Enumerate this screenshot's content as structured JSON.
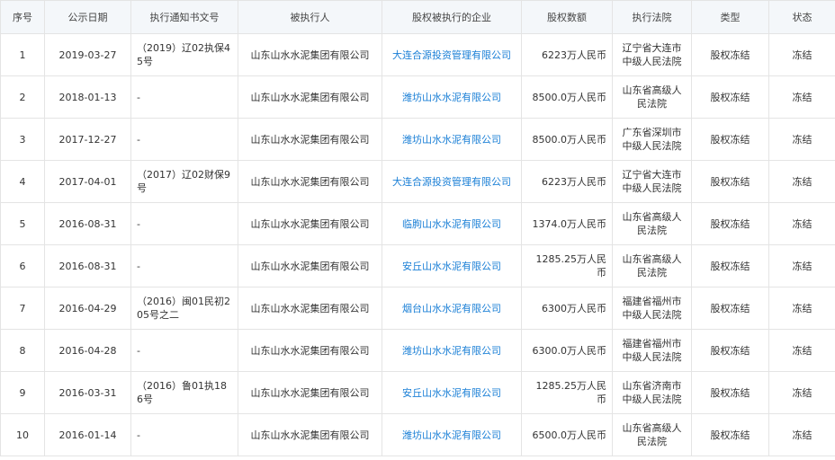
{
  "table": {
    "headers": {
      "index": "序号",
      "date": "公示日期",
      "notice_no": "执行通知书文号",
      "executee": "被执行人",
      "company": "股权被执行的企业",
      "amount": "股权数额",
      "court": "执行法院",
      "type": "类型",
      "status": "状态"
    },
    "rows": [
      {
        "index": "1",
        "date": "2019-03-27",
        "notice_no": "（2019）辽02执保45号",
        "executee": "山东山水水泥集团有限公司",
        "company": "大连合源投资管理有限公司",
        "amount": "6223万人民币",
        "court": "辽宁省大连市中级人民法院",
        "type": "股权冻结",
        "status": "冻结"
      },
      {
        "index": "2",
        "date": "2018-01-13",
        "notice_no": "-",
        "executee": "山东山水水泥集团有限公司",
        "company": "潍坊山水水泥有限公司",
        "amount": "8500.0万人民币",
        "court": "山东省高级人民法院",
        "type": "股权冻结",
        "status": "冻结"
      },
      {
        "index": "3",
        "date": "2017-12-27",
        "notice_no": "-",
        "executee": "山东山水水泥集团有限公司",
        "company": "潍坊山水水泥有限公司",
        "amount": "8500.0万人民币",
        "court": "广东省深圳市中级人民法院",
        "type": "股权冻结",
        "status": "冻结"
      },
      {
        "index": "4",
        "date": "2017-04-01",
        "notice_no": "（2017）辽02财保9号",
        "executee": "山东山水水泥集团有限公司",
        "company": "大连合源投资管理有限公司",
        "amount": "6223万人民币",
        "court": "辽宁省大连市中级人民法院",
        "type": "股权冻结",
        "status": "冻结"
      },
      {
        "index": "5",
        "date": "2016-08-31",
        "notice_no": "-",
        "executee": "山东山水水泥集团有限公司",
        "company": "临朐山水水泥有限公司",
        "amount": "1374.0万人民币",
        "court": "山东省高级人民法院",
        "type": "股权冻结",
        "status": "冻结"
      },
      {
        "index": "6",
        "date": "2016-08-31",
        "notice_no": "-",
        "executee": "山东山水水泥集团有限公司",
        "company": "安丘山水水泥有限公司",
        "amount": "1285.25万人民币",
        "court": "山东省高级人民法院",
        "type": "股权冻结",
        "status": "冻结"
      },
      {
        "index": "7",
        "date": "2016-04-29",
        "notice_no": "（2016）闽01民初205号之二",
        "executee": "山东山水水泥集团有限公司",
        "company": "烟台山水水泥有限公司",
        "amount": "6300万人民币",
        "court": "福建省福州市中级人民法院",
        "type": "股权冻结",
        "status": "冻结"
      },
      {
        "index": "8",
        "date": "2016-04-28",
        "notice_no": "-",
        "executee": "山东山水水泥集团有限公司",
        "company": "潍坊山水水泥有限公司",
        "amount": "6300.0万人民币",
        "court": "福建省福州市中级人民法院",
        "type": "股权冻结",
        "status": "冻结"
      },
      {
        "index": "9",
        "date": "2016-03-31",
        "notice_no": "（2016）鲁01执186号",
        "executee": "山东山水水泥集团有限公司",
        "company": "安丘山水水泥有限公司",
        "amount": "1285.25万人民币",
        "court": "山东省济南市中级人民法院",
        "type": "股权冻结",
        "status": "冻结"
      },
      {
        "index": "10",
        "date": "2016-01-14",
        "notice_no": "-",
        "executee": "山东山水水泥集团有限公司",
        "company": "潍坊山水水泥有限公司",
        "amount": "6500.0万人民币",
        "court": "山东省高级人民法院",
        "type": "股权冻结",
        "status": "冻结"
      }
    ]
  }
}
